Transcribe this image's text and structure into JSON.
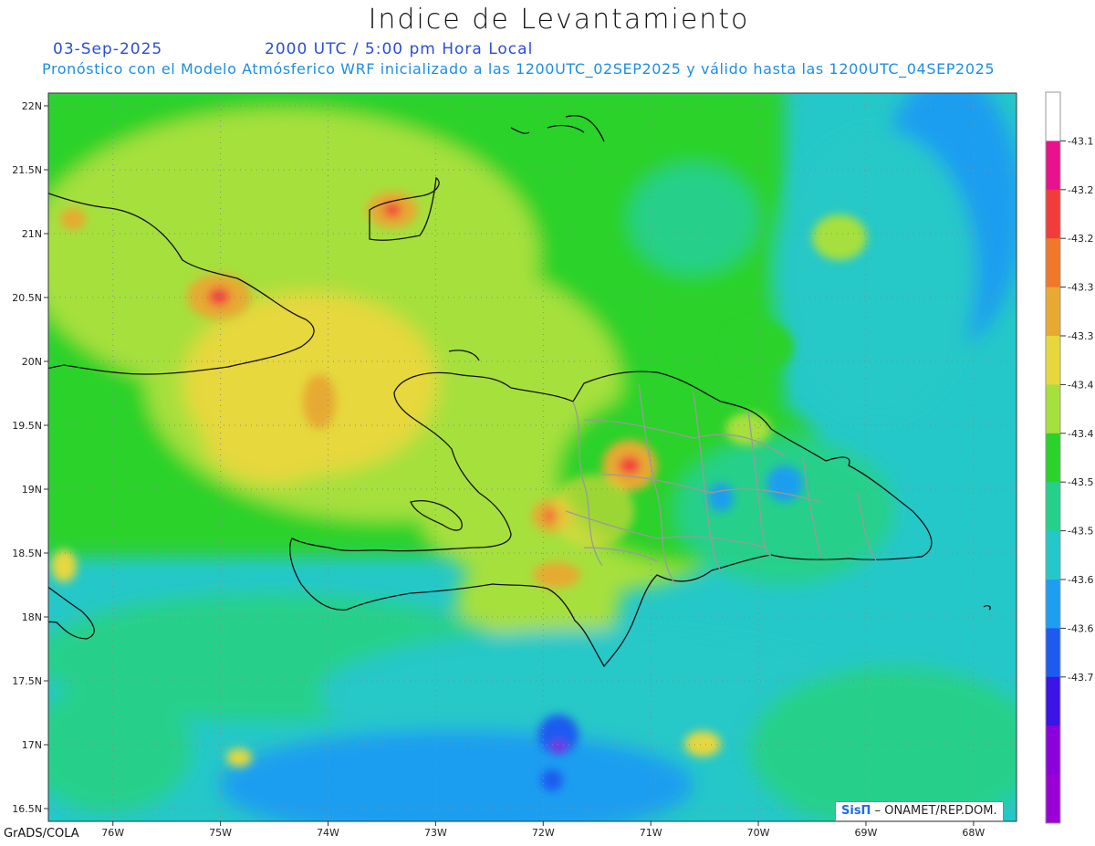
{
  "header": {
    "title": "Indice de Levantamiento",
    "date": "03-Sep-2025",
    "time": "2000 UTC / 5:00 pm Hora Local",
    "description": "Pronóstico con el Modelo Atmósferico WRF inicializado a las 1200UTC_02SEP2025 y válido hasta las  1200UTC_04SEP2025"
  },
  "axes": {
    "lat_labels": [
      "22N",
      "21.5N",
      "21N",
      "20.5N",
      "20N",
      "19.5N",
      "19N",
      "18.5N",
      "18N",
      "17.5N",
      "17N",
      "16.5N"
    ],
    "lat_values": [
      22,
      21.5,
      21,
      20.5,
      20,
      19.5,
      19,
      18.5,
      18,
      17.5,
      17,
      16.5
    ],
    "lon_labels": [
      "76W",
      "75W",
      "74W",
      "73W",
      "72W",
      "71W",
      "70W",
      "69W",
      "68W"
    ],
    "lon_values": [
      -76,
      -75,
      -74,
      -73,
      -72,
      -71,
      -70,
      -69,
      -68
    ],
    "lat_range": [
      16.4,
      22.1
    ],
    "lon_range": [
      -76.6,
      -67.6
    ],
    "grid": true
  },
  "legend": {
    "labels": [
      "-43.1",
      "-43.2",
      "-43.2",
      "-43.3",
      "-43.3",
      "-43.4",
      "-43.4",
      "-43.5",
      "-43.5",
      "-43.6",
      "-43.6",
      "-43.7"
    ],
    "colors": [
      "#ffffff",
      "#e8128c",
      "#f23c3c",
      "#f0782a",
      "#e6aa32",
      "#e6d83c",
      "#a6e03c",
      "#2ad22a",
      "#25d08a",
      "#25c8c8",
      "#1e9ef0",
      "#1e5af0",
      "#3c14e6",
      "#8c00dc",
      "#9a00d6"
    ]
  },
  "footer": {
    "software": "GrADS/COLA"
  },
  "credit": {
    "logo": "SisΠ",
    "org": "– ONAMET/REP.DOM."
  }
}
